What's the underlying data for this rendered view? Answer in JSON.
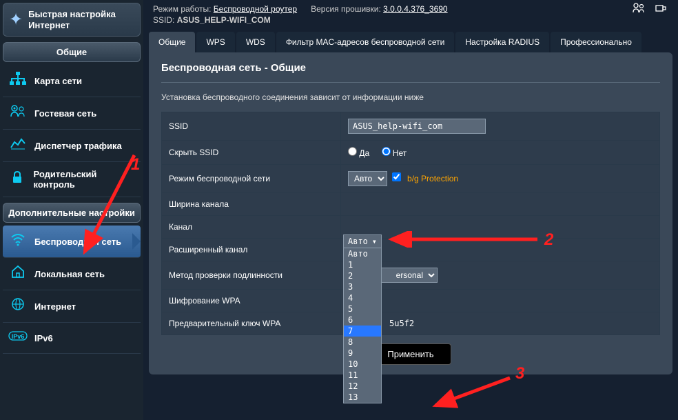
{
  "sidebar": {
    "quick_setup": "Быстрая настройка Интернет",
    "general_header": "Общие",
    "general_items": [
      {
        "label": "Карта сети"
      },
      {
        "label": "Гостевая сеть"
      },
      {
        "label": "Диспетчер трафика"
      },
      {
        "label": "Родительский контроль"
      }
    ],
    "advanced_header": "Дополнительные настройки",
    "advanced_items": [
      {
        "label": "Беспроводная сеть"
      },
      {
        "label": "Локальная сеть"
      },
      {
        "label": "Интернет"
      },
      {
        "label": "IPv6"
      }
    ]
  },
  "top": {
    "mode_label": "Режим работы:",
    "mode_value": "Беспроводной роутер",
    "fw_label": "Версия прошивки:",
    "fw_value": "3.0.0.4.376_3690",
    "ssid_label": "SSID:",
    "ssid_value": "ASUS_HELP-WIFI_COM"
  },
  "tabs": [
    "Общие",
    "WPS",
    "WDS",
    "Фильтр MAC-адресов беспроводной сети",
    "Настройка RADIUS",
    "Профессионально"
  ],
  "page": {
    "title": "Беспроводная сеть - Общие",
    "desc": "Установка беспроводного соединения зависит от информации ниже"
  },
  "form": {
    "ssid_label": "SSID",
    "ssid_value": "ASUS_help-wifi_com",
    "hide_ssid_label": "Скрыть SSID",
    "hide_yes": "Да",
    "hide_no": "Нет",
    "mode_label": "Режим беспроводной сети",
    "mode_value": "Авто",
    "bg_protection": "b/g Protection",
    "width_label": "Ширина канала",
    "channel_label": "Канал",
    "channel_value": "Авто",
    "channel_options": [
      "Авто",
      "1",
      "2",
      "3",
      "4",
      "5",
      "6",
      "7",
      "8",
      "9",
      "10",
      "11",
      "12",
      "13"
    ],
    "ext_channel_label": "Расширенный канал",
    "auth_label": "Метод проверки подлинности",
    "auth_value": "ersonal",
    "enc_label": "Шифрование WPA",
    "key_label": "Предварительный ключ WPA",
    "key_value": "5u5f2",
    "apply": "Применить"
  },
  "annotations": {
    "n1": "1",
    "n2": "2",
    "n3": "3"
  }
}
